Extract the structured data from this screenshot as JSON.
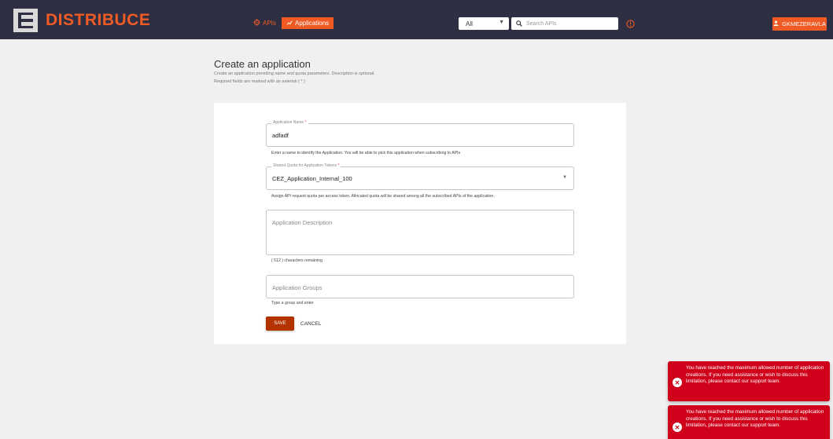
{
  "header": {
    "logo_text": "DISTRIBUCE",
    "nav": {
      "apis_label": "APIs",
      "applications_label": "Applications"
    },
    "filter_select": {
      "value": "All"
    },
    "search": {
      "placeholder": "Search APIs"
    },
    "user_label": "GKMEZERAVLA"
  },
  "page": {
    "title": "Create an application",
    "subtitle_line1": "Create an application providing name and quota parameters. Description is optional.",
    "subtitle_line2": "Required fields are marked with an asterisk ( * )"
  },
  "form": {
    "name": {
      "label": "Application Name",
      "required_mark": "*",
      "value": "adfadf",
      "helper": "Enter a name to identify the Application. You will be able to pick this application when subscribing to APIs"
    },
    "quota": {
      "label": "Shared Quota for Application Tokens",
      "required_mark": "*",
      "value": "CEZ_Application_Internal_100",
      "helper": "Assign API request quota per access token. Allocated quota will be shared among all the subscribed APIs of the application."
    },
    "description": {
      "placeholder": "Application Description",
      "helper": "( 512 ) characters remaining"
    },
    "groups": {
      "placeholder": "Application Groups",
      "helper": "Type a group and enter"
    },
    "save_label": "SAVE",
    "cancel_label": "CANCEL"
  },
  "toasts": [
    {
      "message": "You have reached the maximum allowed number of application creations. If you need assistance or wish to discuss this limitation, please contact our support team."
    },
    {
      "message": "You have reached the maximum allowed number of application creations. If you need assistance or wish to discuss this limitation, please contact our support team."
    }
  ],
  "colors": {
    "brand_orange": "#f05a24",
    "topbar_bg": "#2e2f42",
    "save_button": "#b43200",
    "toast_error": "#d0021b"
  },
  "icons": [
    "logo-icon",
    "gear-icon",
    "chart-icon",
    "chevron-down-icon",
    "search-icon",
    "info-icon",
    "user-icon",
    "error-icon"
  ]
}
